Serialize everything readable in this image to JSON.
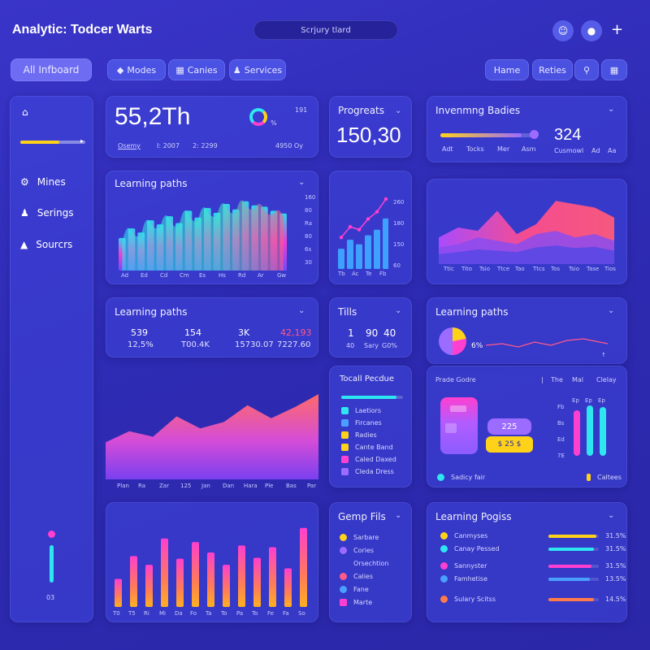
{
  "header": {
    "title": "Analytic: Todcer Warts",
    "search_placeholder": "Scrjury tlard"
  },
  "nav_pills": {
    "primary": "All Infboard",
    "tabs": [
      "Modes",
      "Canies",
      "Services"
    ],
    "right": [
      "Hame",
      "Reties"
    ]
  },
  "sidebar": {
    "items": [
      "Mines",
      "Serings",
      "Sourcrs"
    ],
    "bottom_label": "03"
  },
  "kpi1": {
    "value": "55,2Th",
    "corner": "191",
    "sub": [
      "Osemy",
      "I: 2007",
      "2: 2299",
      "4950 Oy"
    ]
  },
  "kpi2": {
    "title": "Progreats",
    "value": "150,30"
  },
  "kpi3": {
    "title": "Invenmng Badies",
    "value": "324",
    "value_label": "Cusmowl",
    "progress": 0.85,
    "axis": [
      "Adt",
      "Tocks",
      "Mer",
      "Asm"
    ],
    "extra": [
      "Ad",
      "Aa"
    ]
  },
  "learning1": {
    "title": "Learning paths",
    "x": [
      "Ad",
      "Ed",
      "Cd",
      "Cm",
      "Es",
      "Hs",
      "Rd",
      "Ar",
      "Gw"
    ],
    "y": [
      "160",
      "80",
      "Ra",
      "80",
      "6s",
      "30"
    ],
    "values": [
      48,
      62,
      56,
      74,
      68,
      80,
      70,
      88,
      78,
      92,
      85,
      98,
      90,
      102,
      96,
      94,
      88,
      84
    ]
  },
  "mini_chart": {
    "y": [
      "260",
      "180",
      "150",
      "60"
    ],
    "x": [
      "Tb",
      "Ac",
      "Te",
      "Fb"
    ],
    "values": [
      36,
      52,
      44,
      60,
      70,
      90
    ]
  },
  "area1": {
    "x": [
      "Ttic",
      "Tito",
      "Tsio",
      "Ttce",
      "Tao",
      "Ttcs",
      "Tos",
      "Tsio",
      "Tase",
      "Tios"
    ],
    "series_top": [
      40,
      55,
      50,
      80,
      45,
      60,
      95,
      90,
      85,
      70
    ],
    "series_mid": [
      25,
      30,
      40,
      35,
      30,
      45,
      50,
      40,
      45,
      35
    ],
    "series_low": [
      15,
      18,
      22,
      20,
      18,
      25,
      28,
      24,
      26,
      20
    ]
  },
  "stats1": {
    "title": "Learning paths",
    "cols": [
      {
        "v": "539",
        "s": "12,5%"
      },
      {
        "v": "154",
        "s": "T00.4K"
      },
      {
        "v": "3K",
        "s": "15730.07"
      },
      {
        "v": "42,193",
        "s": "7227.60"
      }
    ]
  },
  "tills": {
    "title": "Tills",
    "cols": [
      {
        "v": "1",
        "s": "40"
      },
      {
        "v": "90",
        "s": "Sary"
      },
      {
        "v": "40",
        "s": "G0%"
      }
    ]
  },
  "learning3": {
    "title": "Learning paths",
    "pct": "6%"
  },
  "area2": {
    "x": [
      "Plan",
      "Ra",
      "Zar",
      "125",
      "Jan",
      "Dan",
      "Hara",
      "Ple",
      "Bas",
      "Par"
    ],
    "values": [
      40,
      52,
      46,
      68,
      55,
      62,
      80,
      66,
      78,
      92
    ]
  },
  "tocall": {
    "title": "Tocall Pecdue",
    "items": [
      "Laetiors",
      "Fircanes",
      "Radies",
      "Cante Band",
      "Caled Daxed",
      "Cleda Dress"
    ],
    "colors": [
      "#2ee6f0",
      "#4aa0ff",
      "#ffd21a",
      "#ffd21a",
      "#ff3fd0",
      "#9c6bff"
    ]
  },
  "bars_right": {
    "header": [
      "Prade Godre",
      "The",
      "Mal",
      "Clelay"
    ],
    "ticks": [
      "Fb",
      "Bs",
      "Ed",
      "7E"
    ],
    "badge1": "225",
    "badge2": "$ 25 $",
    "legend": [
      "Sadicy fair",
      "Caltees"
    ],
    "bar_vals": [
      "Ep",
      "Ep",
      "Ep"
    ]
  },
  "bigbars": {
    "x": [
      "T0",
      "T5",
      "Ri",
      "Mi",
      "Da",
      "Fo",
      "Ta",
      "To",
      "Pa",
      "To",
      "Fe",
      "Fa",
      "So"
    ],
    "values": [
      32,
      58,
      48,
      78,
      55,
      74,
      62,
      48,
      70,
      56,
      68,
      44,
      90
    ]
  },
  "gemp": {
    "title": "Gemp Fils",
    "items": [
      "Sarbare",
      "Cories",
      "Orsechtion",
      "Calies",
      "Fane",
      "Marte"
    ],
    "colors": [
      "#ffd21a",
      "#9c6bff",
      "",
      "#ff5a8a",
      "#4aa0ff",
      "#ff3fd0"
    ]
  },
  "lp2": {
    "title": "Learning Pogiss",
    "rows": [
      {
        "label": "Canmyses",
        "value": "31.5%",
        "color": "#ffd21a",
        "fill": 0.95
      },
      {
        "label": "Canay Pessed",
        "value": "31.5%",
        "color": "#2ee6f0",
        "fill": 0.9
      },
      {
        "label": "Sannyster",
        "value": "31.5%",
        "color": "#ff3fd0",
        "fill": 0.85
      },
      {
        "label": "Famhetise",
        "value": "13.5%",
        "color": "#4aa0ff",
        "fill": 0.82
      },
      {
        "label": "Sulary Scitss",
        "value": "14.5%",
        "color": "#ff7a4a",
        "fill": 0.9
      }
    ]
  },
  "colors": {
    "cyan": "#2ee6f0",
    "magenta": "#ff3fd0",
    "yellow": "#ffd21a",
    "purple": "#9c6bff",
    "pink": "#ff5a8a",
    "blue": "#4aa0ff"
  }
}
